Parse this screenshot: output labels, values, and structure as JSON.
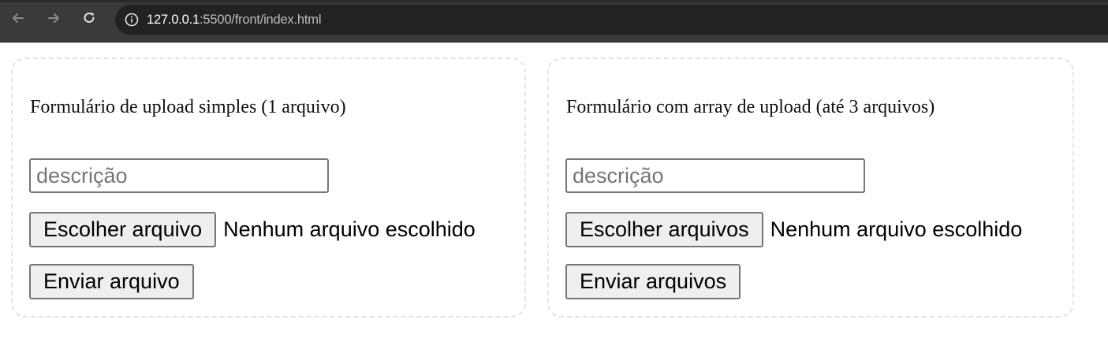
{
  "browser": {
    "url_host": "127.0.0.1",
    "url_path": ":5500/front/index.html",
    "icons": {
      "back": "arrow-left-icon",
      "forward": "arrow-right-icon",
      "reload": "reload-icon",
      "site_info": "info-icon"
    },
    "colors": {
      "toolbar": "#3a3a3a",
      "omnibox": "#222222"
    }
  },
  "forms": {
    "single": {
      "title": "Formulário de upload simples (1 arquivo)",
      "description_placeholder": "descrição",
      "description_value": "",
      "choose_button_label": "Escolher arquivo",
      "file_status": "Nenhum arquivo escolhido",
      "submit_label": "Enviar arquivo"
    },
    "multi": {
      "title": "Formulário com array de upload (até 3 arquivos)",
      "description_placeholder": "descrição",
      "description_value": "",
      "choose_button_label": "Escolher arquivos",
      "file_status": "Nenhum arquivo escolhido",
      "submit_label": "Enviar arquivos"
    }
  }
}
